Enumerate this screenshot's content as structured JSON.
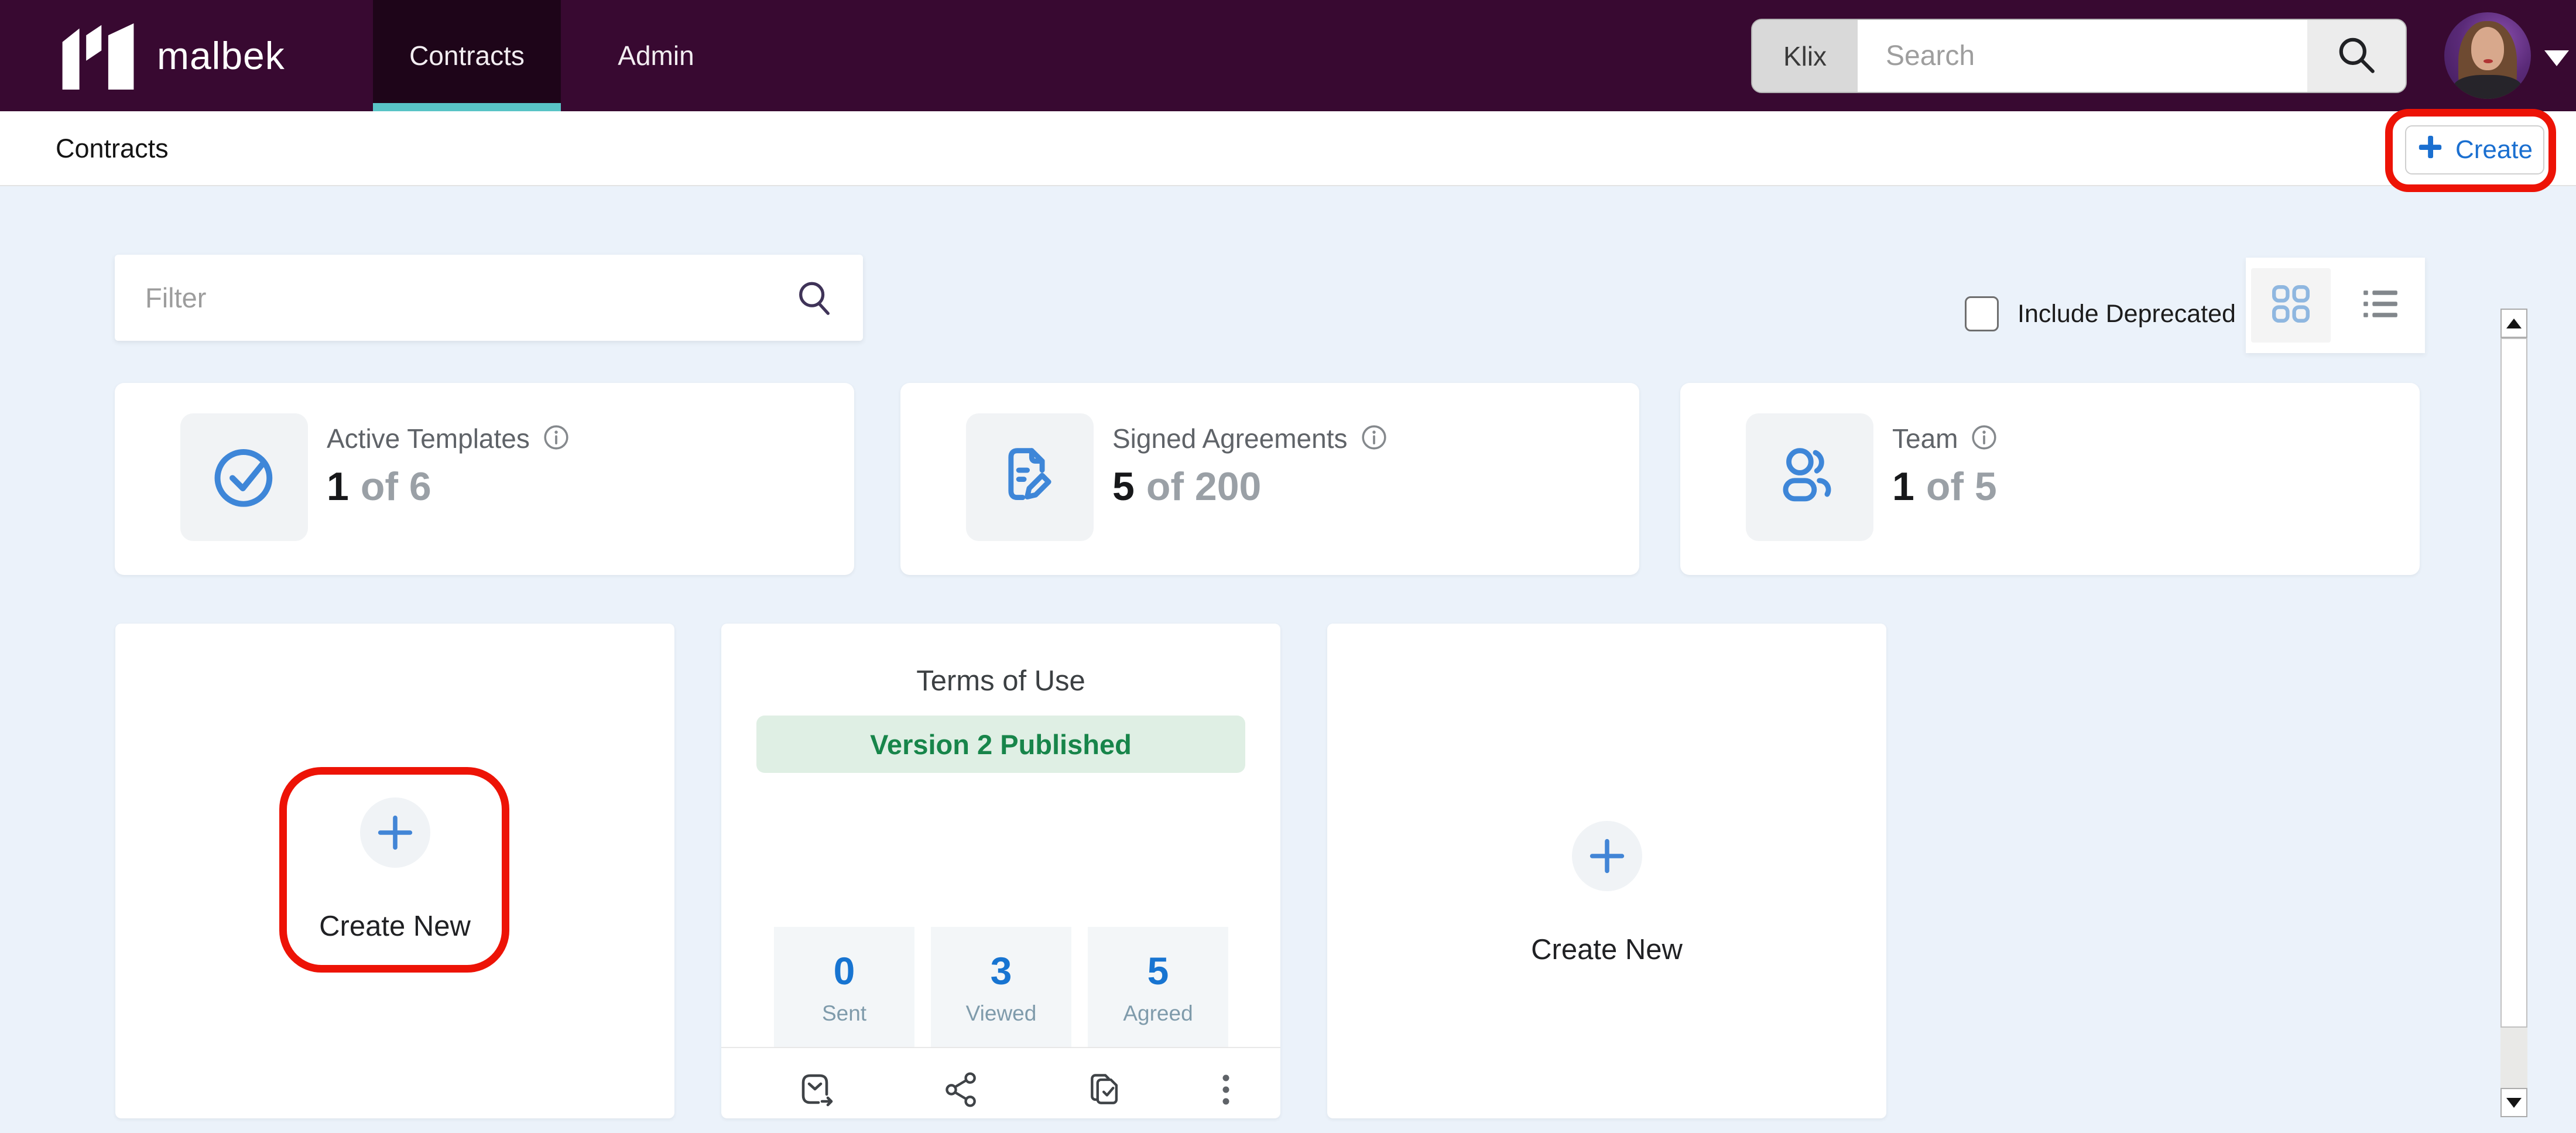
{
  "nav": {
    "brand": "malbek",
    "tabs": [
      {
        "label": "Contracts"
      },
      {
        "label": "Admin"
      }
    ],
    "search": {
      "prefix": "Klix",
      "placeholder": "Search"
    }
  },
  "header": {
    "breadcrumb": "Contracts",
    "create_button": "Create"
  },
  "filter_bar": {
    "placeholder": "Filter",
    "include_deprecated": "Include Deprecated"
  },
  "stat_cards": [
    {
      "title": "Active Templates",
      "value": "1",
      "suffix": "of 6"
    },
    {
      "title": "Signed Agreements",
      "value": "5",
      "suffix": "of 200"
    },
    {
      "title": "Team",
      "value": "1",
      "suffix": "of 5"
    }
  ],
  "cards": {
    "create_new": "Create New",
    "terms": {
      "title": "Terms of Use",
      "badge": "Version 2 Published",
      "stats": [
        {
          "value": "0",
          "label": "Sent"
        },
        {
          "value": "3",
          "label": "Viewed"
        },
        {
          "value": "5",
          "label": "Agreed"
        }
      ]
    }
  },
  "colors": {
    "nav_purple": "#380931",
    "active_tab": "#1E0519",
    "teal_underline": "#59C4C6",
    "page_background": "#EBF2FA",
    "accent_blue": "#1A6FD0",
    "stat_icon_blue": "#3E86D8",
    "badge_green_text": "#17854A",
    "badge_green_bg": "#DFEFE4",
    "annotation_red": "#ED1306"
  }
}
